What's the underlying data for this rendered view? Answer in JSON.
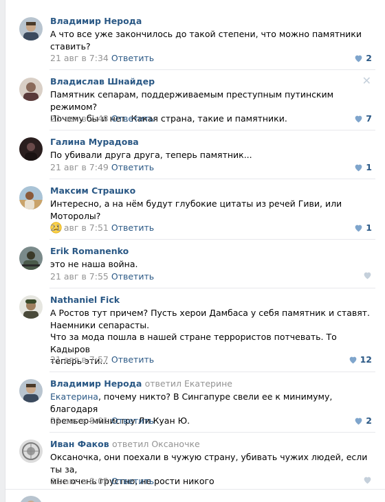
{
  "comments": [
    {
      "author": "Владимир Нерода",
      "reply_to": "",
      "lines": [
        "А что все уже закончилось до такой степени, что можно памятники",
        "ставить?"
      ],
      "date": "21 авг в 7:34",
      "reply_label": "Ответить",
      "likes": "2",
      "avatar_color": "#6b7a8d"
    },
    {
      "author": "Владислав Шнайдер",
      "reply_to": "",
      "lines": [
        "Памятник сепарам, поддерживаемым преступным путинским режимом?",
        "Почему бы и нет. Какая страна, такие и памятники."
      ],
      "date": "21 авг в 7:48",
      "reply_label": "Ответить",
      "likes": "7",
      "avatar_color": "#8a6a5a"
    },
    {
      "author": "Галина Мурадова",
      "reply_to": "",
      "lines": [
        "По убивали друга друга, теперь памятник..."
      ],
      "date": "21 авг в 7:49",
      "reply_label": "Ответить",
      "likes": "1",
      "avatar_color": "#3a2a2a"
    },
    {
      "author": "Максим Страшко",
      "reply_to": "",
      "lines": [
        "Интересно, а на нём будут глубокие цитаты из речей Гиви, или Моторолы?"
      ],
      "date": "21 авг в 7:51",
      "reply_label": "Ответить",
      "likes": "1",
      "avatar_color": "#c9a36a"
    },
    {
      "author": "Erik Romanenko",
      "reply_to": "",
      "lines": [
        "это не наша война."
      ],
      "date": "21 авг в 7:55",
      "reply_label": "Ответить",
      "likes": "",
      "avatar_color": "#5a6a6a"
    },
    {
      "author": "Nathaniel Fick",
      "reply_to": "",
      "lines": [
        "А Ростов тут причем? Пусть херои Дамбаса у себя памятник и ставят.",
        "Наемники сепарасты.",
        "Что за мода пошла в нашей стране террористов потчевать. То Кадыров",
        "теперь эти..."
      ],
      "date": "21 авг в 7:57",
      "reply_label": "Ответить",
      "likes": "12",
      "avatar_color": "#4a4a3a"
    },
    {
      "author": "Владимир Нерода",
      "reply_to": "ответил Екатерине",
      "mention": "Екатерина",
      "lines": [
        ", почему никто? В Сингапуре свели ее к минимуму, благодаря",
        "премьер-министру Ли Куан Ю."
      ],
      "date": "21 авг в 8:01",
      "reply_label": "Ответить",
      "likes": "2",
      "avatar_color": "#6b7a8d"
    },
    {
      "author": "Иван Факов",
      "reply_to": "ответил Оксаночке",
      "lines": [
        "Оксаночка, они поехали в чужую страну, убивать чужих людей, если ты за,",
        "мне очень грустно, не рости никого"
      ],
      "date": "21 авг в 8:05",
      "reply_label": "Ответить",
      "likes": "",
      "avatar_color": "#9a9a9a"
    }
  ],
  "colors": {
    "link": "#2a5885",
    "meta": "#939393",
    "like_icon": "#7fa5cc",
    "like_empty": "#c5d0db"
  }
}
